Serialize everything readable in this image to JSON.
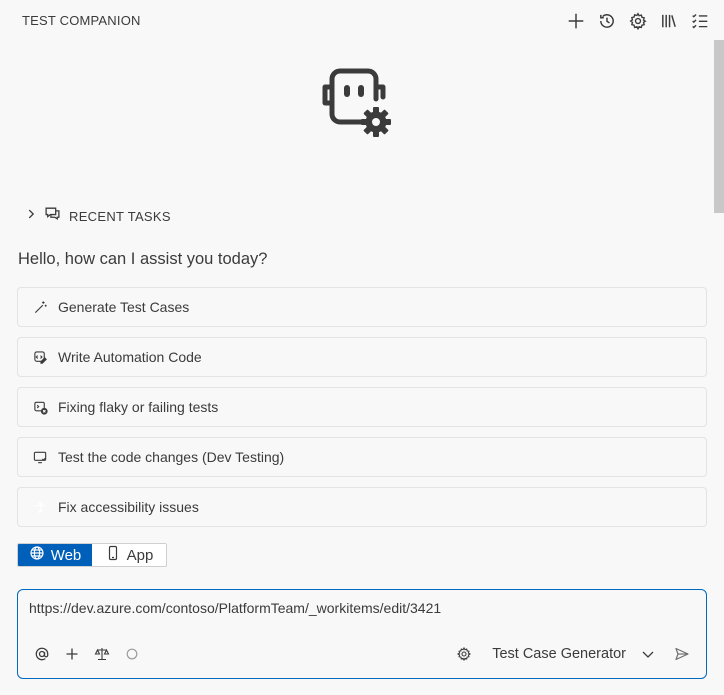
{
  "header": {
    "title": "TEST COMPANION",
    "actions": [
      {
        "name": "new-icon"
      },
      {
        "name": "history-icon"
      },
      {
        "name": "settings-icon"
      },
      {
        "name": "library-icon"
      },
      {
        "name": "checklist-icon"
      }
    ]
  },
  "recent_tasks": {
    "label": "RECENT TASKS"
  },
  "greeting": "Hello, how can I assist you today?",
  "tasks": [
    {
      "label": "Generate Test Cases",
      "icon": "magic-wand-icon"
    },
    {
      "label": "Write Automation Code",
      "icon": "code-edit-icon"
    },
    {
      "label": "Fixing flaky or failing tests",
      "icon": "bug-fix-icon"
    },
    {
      "label": "Test the code changes (Dev Testing)",
      "icon": "screen-test-icon"
    },
    {
      "label": "Fix accessibility issues",
      "icon": "accessibility-icon"
    }
  ],
  "platform_toggle": {
    "web_label": "Web",
    "app_label": "App",
    "selected": "Web"
  },
  "input": {
    "value": "https://dev.azure.com/contoso/PlatformTeam/_workitems/edit/3421",
    "mode_label": "Test Case Generator"
  },
  "colors": {
    "accent": "#005fb8",
    "background": "#f8f8f8",
    "text": "#3b3b3b",
    "border": "#e3e3e3"
  }
}
